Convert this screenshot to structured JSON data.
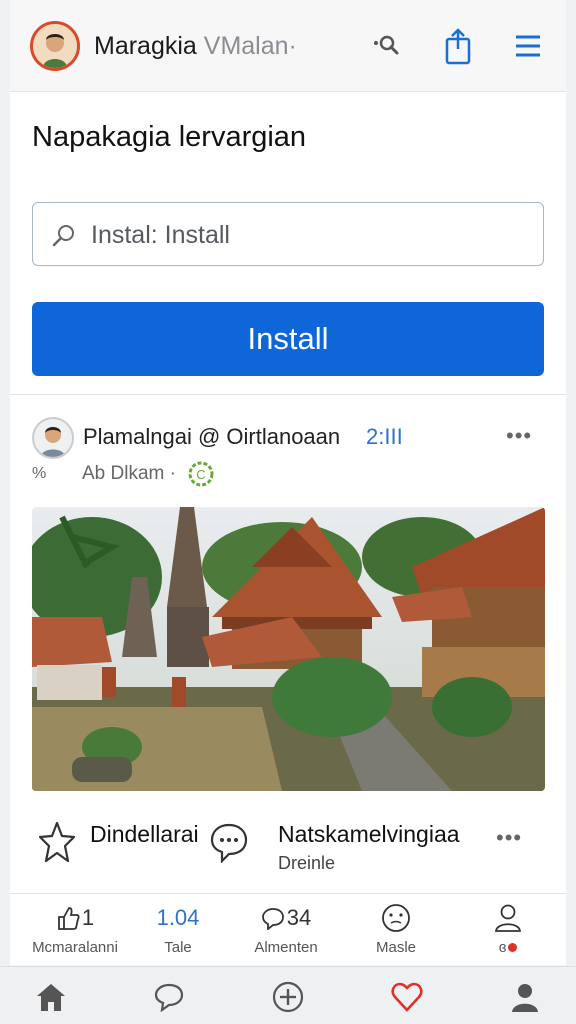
{
  "header": {
    "title_strong": "Maragkia",
    "title_faint": "VMalan·",
    "icons": [
      "avatar",
      "search-icon",
      "share-icon",
      "menu-icon"
    ]
  },
  "card": {
    "title": "Napakagia lervargian",
    "search": {
      "value": "Instal: Install",
      "icon": "search-icon"
    },
    "install_label": "Install"
  },
  "post": {
    "author": "Plamalngai @ Oirtlanoaan",
    "time": "2:III",
    "more": "•••",
    "meta_left": "%",
    "meta": "Ab Dlkam ·",
    "photo_alt_icon": "temple-photo",
    "actions": {
      "first_label": "Dindellarai",
      "second_label": "Natskamelvingiaa",
      "second_sub": "Dreinle",
      "more": "•••"
    }
  },
  "stats": [
    {
      "icon": "like-icon",
      "count": "1",
      "label": "Mcmaralanni"
    },
    {
      "icon": "",
      "count": "1.04",
      "label": "Tale"
    },
    {
      "icon": "comment-icon",
      "count": "34",
      "label": "Almenten"
    },
    {
      "icon": "smile-icon",
      "count": "",
      "label": "Masle"
    },
    {
      "icon": "person-icon",
      "count": "",
      "label": "ɞ"
    }
  ],
  "bottom_nav": [
    "home-icon",
    "chat-icon",
    "add-icon",
    "heart-icon",
    "profile-icon"
  ],
  "colors": {
    "accent": "#0e66d8",
    "link": "#2f72c7",
    "heart": "#e0302a"
  }
}
